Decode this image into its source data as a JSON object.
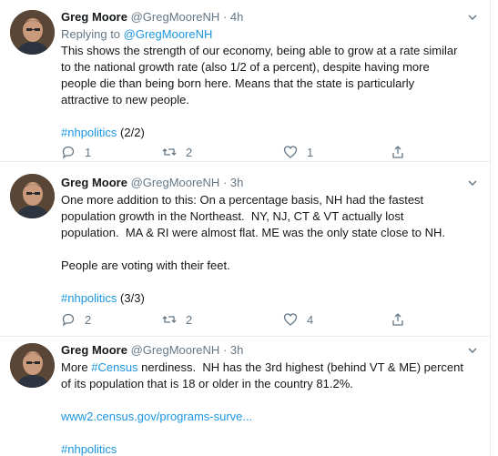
{
  "tweets": [
    {
      "name": "Greg Moore",
      "handle": "@GregMooreNH",
      "separator": "·",
      "time": "4h",
      "replying_to_prefix": "Replying to ",
      "replying_to_handle": "@GregMooreNH",
      "text": "This shows the strength of our economy, being able to grow at a rate similar\nto the national growth rate (also 1/2 of a percent), despite having more\npeople die than being born here. Means that the state is particularly\nattractive to new people.",
      "hashtag": "#nhpolitics",
      "hashtag_suffix": " (2/2)",
      "replies": "1",
      "retweets": "2",
      "likes": "1"
    },
    {
      "name": "Greg Moore",
      "handle": "@GregMooreNH",
      "separator": "·",
      "time": "3h",
      "text": "One more addition to this: On a percentage basis, NH had the fastest\npopulation growth in the Northeast.  NY, NJ, CT & VT actually lost\npopulation.  MA & RI were almost flat. ME was the only state close to NH.\n\nPeople are voting with their feet.",
      "hashtag": "#nhpolitics",
      "hashtag_suffix": " (3/3)",
      "replies": "2",
      "retweets": "2",
      "likes": "4"
    },
    {
      "name": "Greg Moore",
      "handle": "@GregMooreNH",
      "separator": "·",
      "time": "3h",
      "text_prefix": "More ",
      "text_hashtag": "#Census",
      "text_rest": " nerdiness.  NH has the 3rd highest (behind VT & ME) percent\nof its population that is 18 or older in the country 81.2%.",
      "url": "www2.census.gov/programs-surve...",
      "hashtag": "#nhpolitics"
    }
  ],
  "colors": {
    "link": "#1b95e0",
    "secondary_text": "#657786",
    "border": "#e6ecf0"
  },
  "icons": [
    "avatar",
    "chevron-down-icon",
    "reply-icon",
    "retweet-icon",
    "like-icon",
    "share-icon"
  ]
}
